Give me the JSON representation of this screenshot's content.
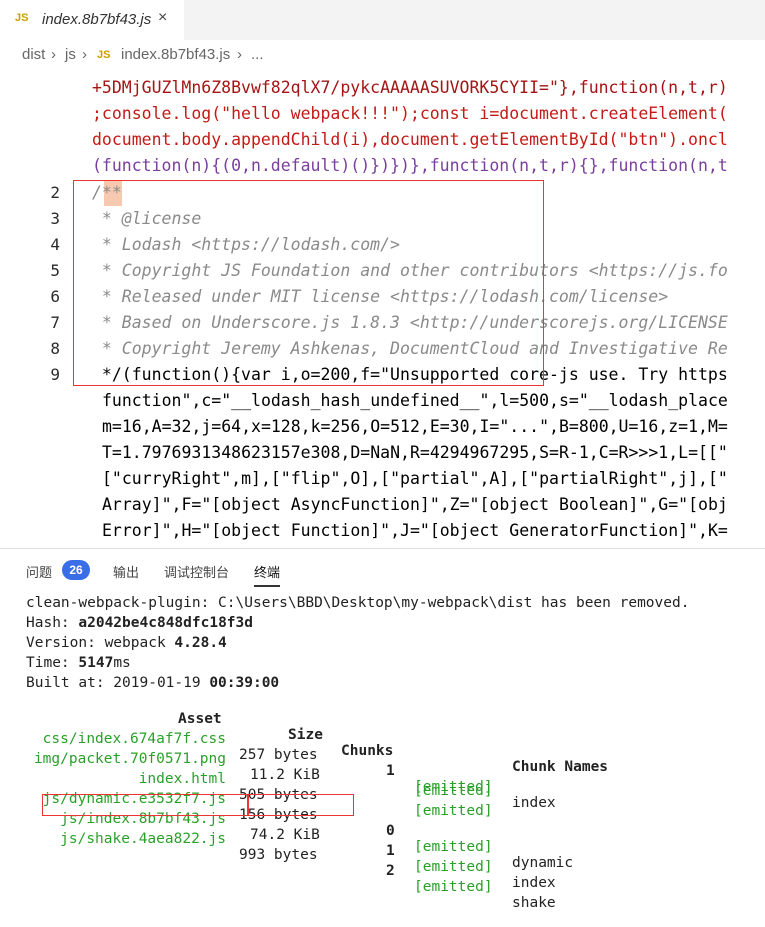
{
  "tab": {
    "badge": "JS",
    "title": "index.8b7bf43.js",
    "close": "×"
  },
  "breadcrumb": {
    "dist": "dist",
    "js": "js",
    "file": "index.8b7bf43.js",
    "more": "...",
    "sep": "›",
    "badge": "JS"
  },
  "code": {
    "top_lines": [
      "+5DMjGUZlMn6Z8Bvwf82qlX7/pykcAAAAASUVORK5CYII=\"},function(n,t,r)",
      ";console.log(\"hello webpack!!!\");const i=document.createElement(",
      "document.body.appendChild(i),document.getElementById(\"btn\").oncl",
      "(function(n){(0,n.default)()})})},function(n,t,r){},function(n,t"
    ],
    "numbered_lines": [
      {
        "n": "2",
        "text": "/**"
      },
      {
        "n": "3",
        "text": " * @license"
      },
      {
        "n": "4",
        "text": " * Lodash <https://lodash.com/>"
      },
      {
        "n": "5",
        "text": " * Copyright JS Foundation and other contributors <https://js.fo"
      },
      {
        "n": "6",
        "text": " * Released under MIT license <https://lodash.com/license>"
      },
      {
        "n": "7",
        "text": " * Based on Underscore.js 1.8.3 <http://underscorejs.org/LICENSE"
      },
      {
        "n": "8",
        "text": " * Copyright Jeremy Ashkenas, DocumentCloud and Investigative Re"
      },
      {
        "n": "9",
        "text": " */(function(){var i,o=200,f=\"Unsupported core-js use. Try https"
      }
    ],
    "wrap_lines": [
      "function\",c=\"__lodash_hash_undefined__\",l=500,s=\"__lodash_place",
      "m=16,A=32,j=64,x=128,k=256,O=512,E=30,I=\"...\",B=800,U=16,z=1,M=",
      "T=1.7976931348623157e308,D=NaN,R=4294967295,S=R-1,C=R>>>1,L=[[\"",
      "[\"curryRight\",m],[\"flip\",O],[\"partial\",A],[\"partialRight\",j],[\"",
      "Array]\",F=\"[object AsyncFunction]\",Z=\"[object Boolean]\",G=\"[obj",
      "Error]\",H=\"[object Function]\",J=\"[object GeneratorFunction]\",K="
    ]
  },
  "panel": {
    "tabs": [
      "问题",
      "输出",
      "调试控制台",
      "终端"
    ],
    "problems_count": "26",
    "terminal": {
      "line1": "clean-webpack-plugin: C:\\Users\\BBD\\Desktop\\my-webpack\\dist has been removed.",
      "hash_label": "Hash: ",
      "hash": "a2042be4c848dfc18f3d",
      "version_label": "Version: webpack ",
      "version": "4.28.4",
      "time_label": "Time: ",
      "time": "5147",
      "time_unit": "ms",
      "built_label": "Built at: 2019-01-19 ",
      "built_time": "00:39:00",
      "headers": {
        "asset": "Asset",
        "size": "Size",
        "chunks": "Chunks",
        "chunk_names": "Chunk Names"
      },
      "rows": [
        {
          "asset": "css/index.674af7f.css",
          "size": "257 bytes",
          "chunk": "1",
          "status": "[emitted]",
          "name": "index"
        },
        {
          "asset": "img/packet.70f0571.png",
          "size": "11.2 KiB",
          "chunk": "",
          "status": "[emitted]",
          "name": ""
        },
        {
          "asset": "index.html",
          "size": "505 bytes",
          "chunk": "",
          "status": "[emitted]",
          "name": ""
        },
        {
          "asset": "js/dynamic.e3532f7.js",
          "size": "156 bytes",
          "chunk": "0",
          "status": "[emitted]",
          "name": "dynamic"
        },
        {
          "asset": "js/index.8b7bf43.js",
          "size": "74.2 KiB",
          "chunk": "1",
          "status": "[emitted]",
          "name": "index"
        },
        {
          "asset": "js/shake.4aea822.js",
          "size": "993 bytes",
          "chunk": "2",
          "status": "[emitted]",
          "name": "shake"
        }
      ]
    }
  },
  "colors": {
    "accent": "#3a6ee8",
    "emitted": "#2aa02a",
    "highlight_box": "#e33333"
  }
}
